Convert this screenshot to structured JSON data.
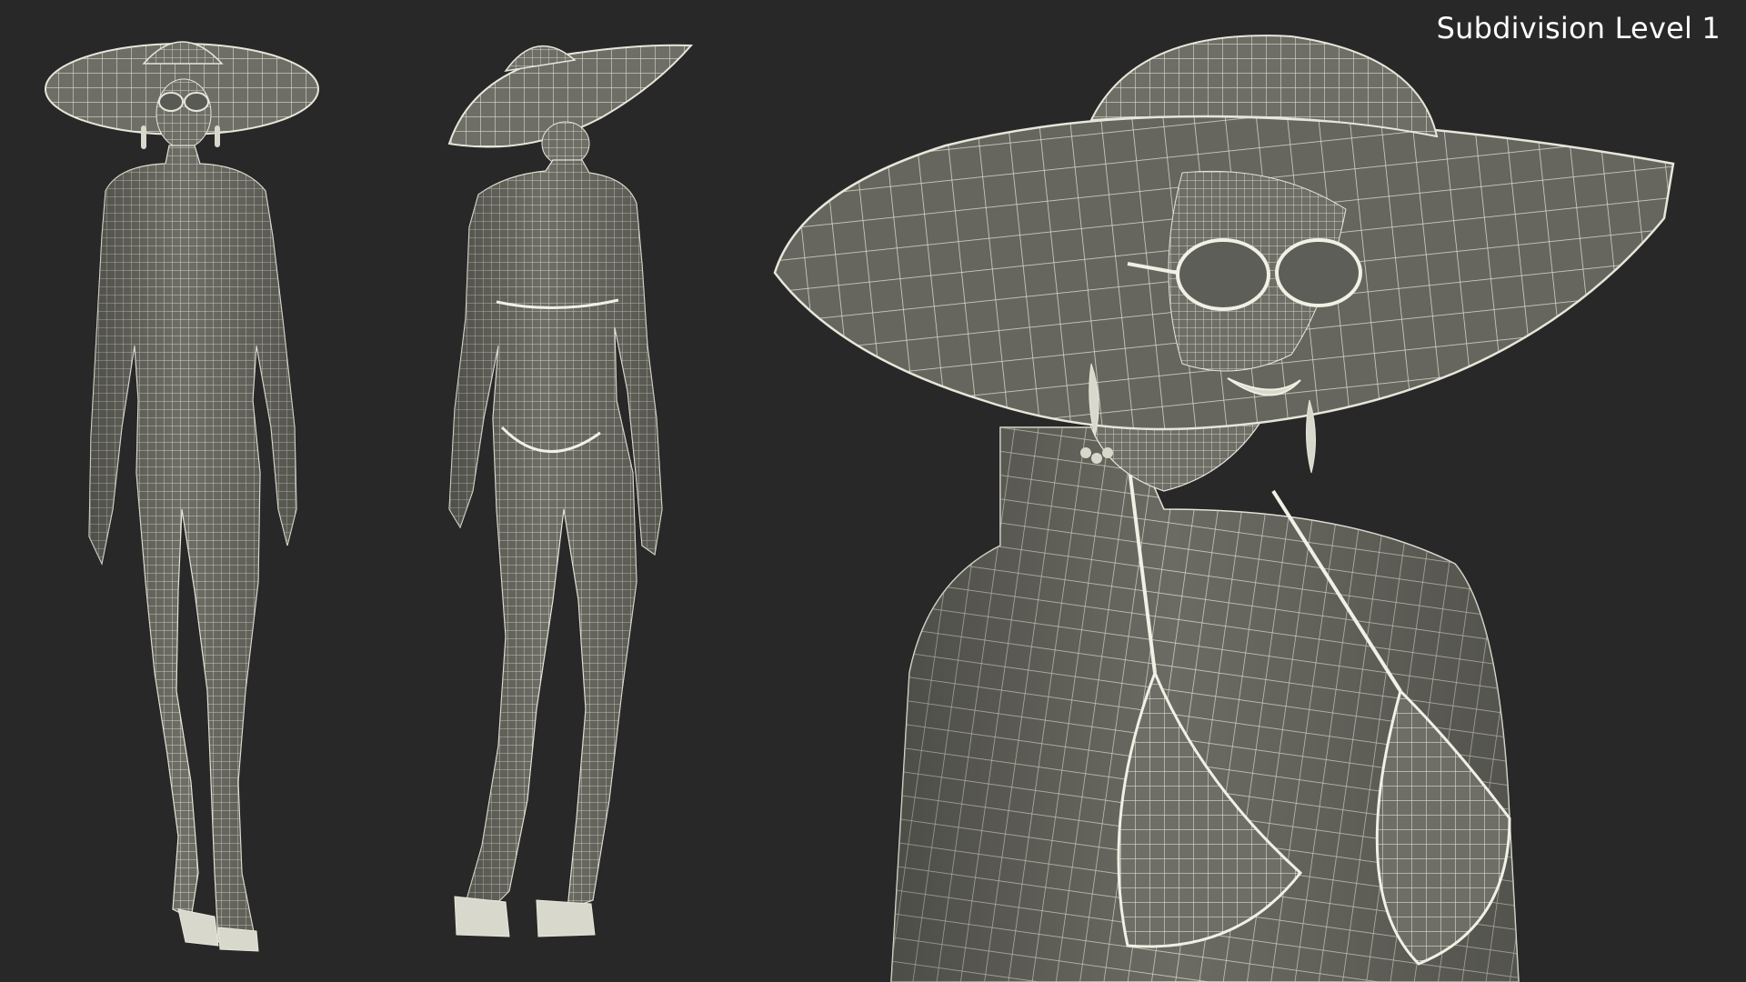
{
  "viewport": {
    "caption": "Subdivision Level 1"
  },
  "colors": {
    "background": "#282828",
    "mesh_fill": "#6e6e66",
    "mesh_shade": "#55554e",
    "wire": "#e6e6da",
    "caption_text": "#ffffff"
  }
}
